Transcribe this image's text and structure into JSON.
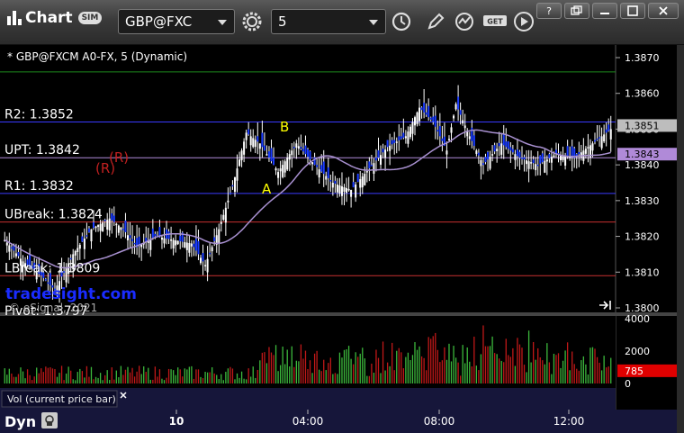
{
  "app": {
    "title": "Chart",
    "badge": "SIM",
    "symbol": "GBP@FXC",
    "interval": "5"
  },
  "chart": {
    "header": "* GBP@FXCM A0-FX, 5 (Dynamic)",
    "watermark": "tradesight.com",
    "copyright": "© eSignal, 2021",
    "footer_label": "Dyn",
    "volume_label": "Vol (current price bar)",
    "levels": [
      {
        "label": "R2: 1.3852",
        "value": 1.3852,
        "color": "#3a3aff"
      },
      {
        "label": "UPT: 1.3842",
        "value": 1.3842,
        "color": "#b08ad8"
      },
      {
        "label": "R1: 1.3832",
        "value": 1.3832,
        "color": "#3a3aff"
      },
      {
        "label": "UBreak: 1.3824",
        "value": 1.3824,
        "color": "#c83030"
      },
      {
        "label": "LBreak: 1.3809",
        "value": 1.3809,
        "color": "#c83030"
      },
      {
        "label": "Pivot: 1.3797",
        "value": 1.3797,
        "color": "#3a3aff"
      }
    ],
    "top_line": {
      "value": 1.3866,
      "color": "#1c8a1c"
    },
    "price_ticks": [
      "1.3870",
      "1.3860",
      "1.3850",
      "1.3840",
      "1.3830",
      "1.3820",
      "1.3810",
      "1.3800"
    ],
    "price_tick_values": [
      1.387,
      1.386,
      1.385,
      1.384,
      1.383,
      1.382,
      1.381,
      1.38
    ],
    "price_tags": [
      {
        "label": "1.3851",
        "value": 1.3851,
        "bg": "#bdbdbd",
        "fg": "#000"
      },
      {
        "label": "1.3843",
        "value": 1.3843,
        "bg": "#b08ad8",
        "fg": "#000"
      }
    ],
    "volume_ticks": [
      "4000",
      "2000",
      "0"
    ],
    "volume_tick_values": [
      4000,
      2000,
      0
    ],
    "volume_tag": {
      "label": "785",
      "value": 785,
      "bg": "#e00000"
    },
    "time_ticks": [
      "10",
      "04:00",
      "08:00",
      "12:00"
    ],
    "annotations": [
      {
        "text": "A",
        "color": "#ffff00"
      },
      {
        "text": "B",
        "color": "#ffff00"
      },
      {
        "text": "(R)",
        "color": "#c02020"
      },
      {
        "text": "(R)",
        "color": "#c02020"
      }
    ]
  },
  "colors": {
    "up": "#ffffff",
    "down": "#1a3cff",
    "vol_up": "#3cb83c",
    "vol_down": "#c01818",
    "ma": "#a890d0",
    "panel": "#16163a"
  }
}
